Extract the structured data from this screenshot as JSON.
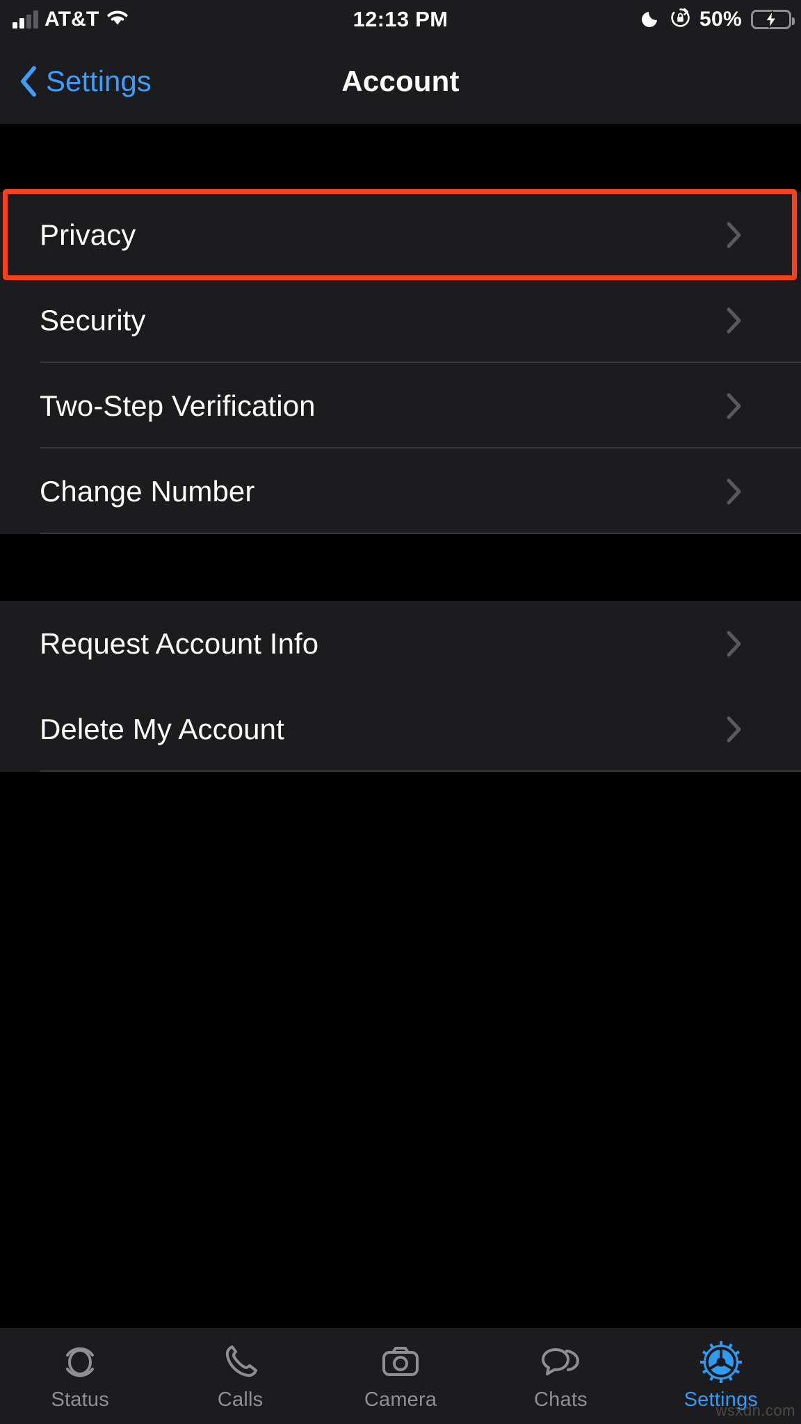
{
  "status_bar": {
    "carrier": "AT&T",
    "time": "12:13 PM",
    "battery_percent": "50%",
    "signal_icon": "cellular-signal-icon",
    "wifi_icon": "wifi-icon",
    "dnd_icon": "moon-icon",
    "rotation_lock_icon": "rotation-lock-icon",
    "battery_icon": "battery-charging-icon",
    "battery_fill_pct": 50,
    "battery_color": "#32d74b"
  },
  "nav": {
    "back_label": "Settings",
    "title": "Account",
    "accent_color": "#3b9dfd"
  },
  "groups": [
    {
      "rows": [
        {
          "label": "Privacy",
          "highlighted": true
        },
        {
          "label": "Security",
          "highlighted": false
        },
        {
          "label": "Two-Step Verification",
          "highlighted": false
        },
        {
          "label": "Change Number",
          "highlighted": false
        }
      ]
    },
    {
      "rows": [
        {
          "label": "Request Account Info",
          "highlighted": false
        },
        {
          "label": "Delete My Account",
          "highlighted": false
        }
      ]
    }
  ],
  "highlight": {
    "color": "#f8401a",
    "target_label": "Privacy"
  },
  "tabs": [
    {
      "label": "Status",
      "icon": "status-rings-icon",
      "active": false
    },
    {
      "label": "Calls",
      "icon": "phone-icon",
      "active": false
    },
    {
      "label": "Camera",
      "icon": "camera-icon",
      "active": false
    },
    {
      "label": "Chats",
      "icon": "chat-bubbles-icon",
      "active": false
    },
    {
      "label": "Settings",
      "icon": "gear-icon",
      "active": true
    }
  ],
  "tab_active_color": "#2f9cf4",
  "tab_inactive_color": "#8e8e93",
  "watermark": "wsxdn.com"
}
